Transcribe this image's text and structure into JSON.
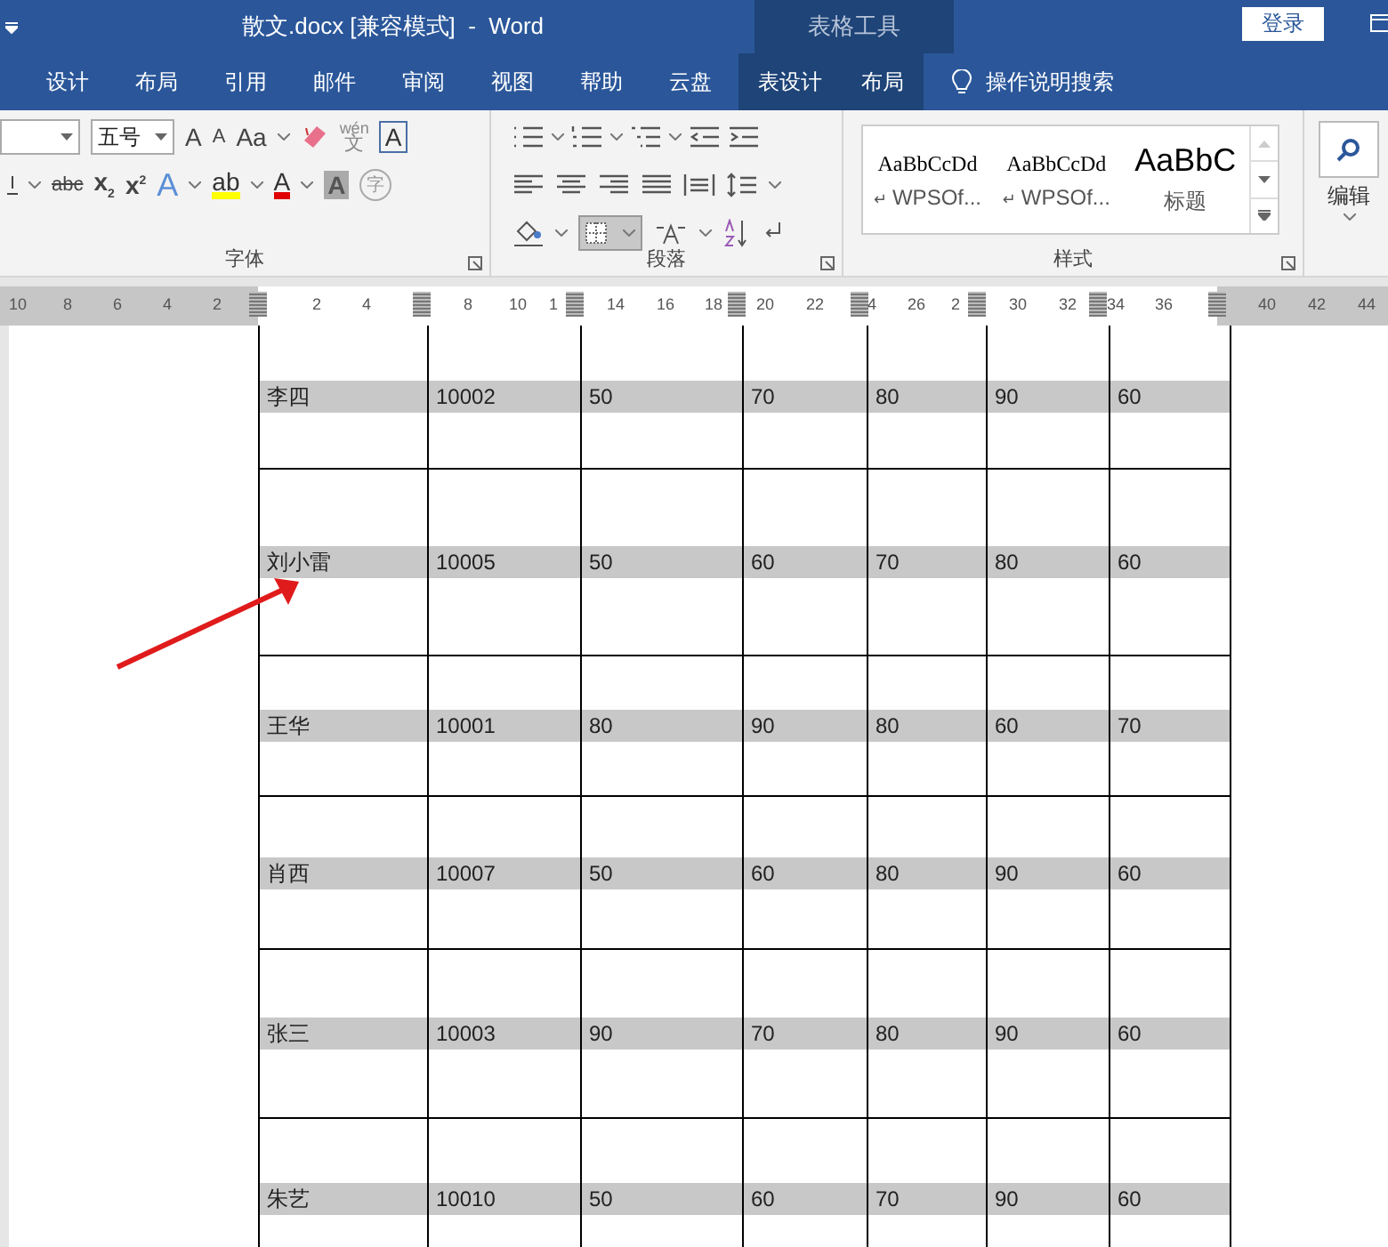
{
  "window": {
    "title": "散文.docx [兼容模式]  -  Word",
    "context_label": "表格工具",
    "sign_in": "登录"
  },
  "tabs": [
    {
      "label": "设计",
      "context": false,
      "selected": false
    },
    {
      "label": "布局",
      "context": false,
      "selected": false
    },
    {
      "label": "引用",
      "context": false,
      "selected": false
    },
    {
      "label": "邮件",
      "context": false,
      "selected": false
    },
    {
      "label": "审阅",
      "context": false,
      "selected": false
    },
    {
      "label": "视图",
      "context": false,
      "selected": false
    },
    {
      "label": "帮助",
      "context": false,
      "selected": false
    },
    {
      "label": "云盘",
      "context": false,
      "selected": false
    },
    {
      "label": "表设计",
      "context": true,
      "selected": false
    },
    {
      "label": "布局",
      "context": true,
      "selected": false
    }
  ],
  "tell_me": "操作说明搜索",
  "font_group": {
    "label": "字体",
    "size": "五号",
    "grow": "A",
    "shrink": "A",
    "case": "Aa",
    "phonetic_top": "wén",
    "phonetic_bottom": "文",
    "border_char": "A",
    "strike": "abc",
    "sub": "x",
    "sub_digit": "2",
    "sup": "x",
    "sup_digit": "2",
    "effect": "A",
    "highlight": "ab",
    "font_color": "A",
    "shading": "A",
    "enclose": "字"
  },
  "paragraph_group": {
    "label": "段落",
    "borders_selected": true
  },
  "styles_group": {
    "label": "样式",
    "styles": [
      {
        "sample": "AaBbCcDd",
        "mark": "↵",
        "name": "WPSOf...",
        "kind": "body"
      },
      {
        "sample": "AaBbCcDd",
        "mark": "↵",
        "name": "WPSOf...",
        "kind": "body"
      },
      {
        "sample": "AaBbC",
        "name": "标题",
        "kind": "heading"
      }
    ]
  },
  "editing_group": {
    "label": "编辑"
  },
  "ruler": [
    {
      "text": "10",
      "kind": "num"
    },
    {
      "text": "8",
      "kind": "num"
    },
    {
      "text": "6",
      "kind": "num"
    },
    {
      "text": "4",
      "kind": "num"
    },
    {
      "text": "2",
      "kind": "num"
    },
    {
      "kind": "marker"
    },
    {
      "text": "2",
      "kind": "num"
    },
    {
      "text": "4",
      "kind": "num"
    },
    {
      "kind": "marker"
    },
    {
      "text": "8",
      "kind": "num"
    },
    {
      "text": "10",
      "kind": "num"
    },
    {
      "text": "1",
      "kind": "num"
    },
    {
      "kind": "marker"
    },
    {
      "text": "14",
      "kind": "num"
    },
    {
      "text": "16",
      "kind": "num"
    },
    {
      "text": "18",
      "kind": "num"
    },
    {
      "kind": "marker"
    },
    {
      "text": "20",
      "kind": "num"
    },
    {
      "text": "22",
      "kind": "num"
    },
    {
      "kind": "marker"
    },
    {
      "text": "4",
      "kind": "num"
    },
    {
      "text": "26",
      "kind": "num"
    },
    {
      "text": "2",
      "kind": "num"
    },
    {
      "kind": "marker"
    },
    {
      "text": "30",
      "kind": "num"
    },
    {
      "text": "32",
      "kind": "num"
    },
    {
      "kind": "marker"
    },
    {
      "text": "34",
      "kind": "num"
    },
    {
      "text": "36",
      "kind": "num"
    },
    {
      "kind": "marker"
    },
    {
      "text": "40",
      "kind": "num"
    },
    {
      "text": "42",
      "kind": "num"
    },
    {
      "text": "44",
      "kind": "num"
    }
  ],
  "table": {
    "rows": [
      [
        "李四",
        "10002",
        "50",
        "70",
        "80",
        "90",
        "60"
      ],
      [
        "刘小雷",
        "10005",
        "50",
        "60",
        "70",
        "80",
        "60"
      ],
      [
        "王华",
        "10001",
        "80",
        "90",
        "80",
        "60",
        "70"
      ],
      [
        "肖西",
        "10007",
        "50",
        "60",
        "80",
        "90",
        "60"
      ],
      [
        "张三",
        "10003",
        "90",
        "70",
        "80",
        "90",
        "60"
      ],
      [
        "朱艺",
        "10010",
        "50",
        "60",
        "70",
        "90",
        "60"
      ]
    ]
  }
}
